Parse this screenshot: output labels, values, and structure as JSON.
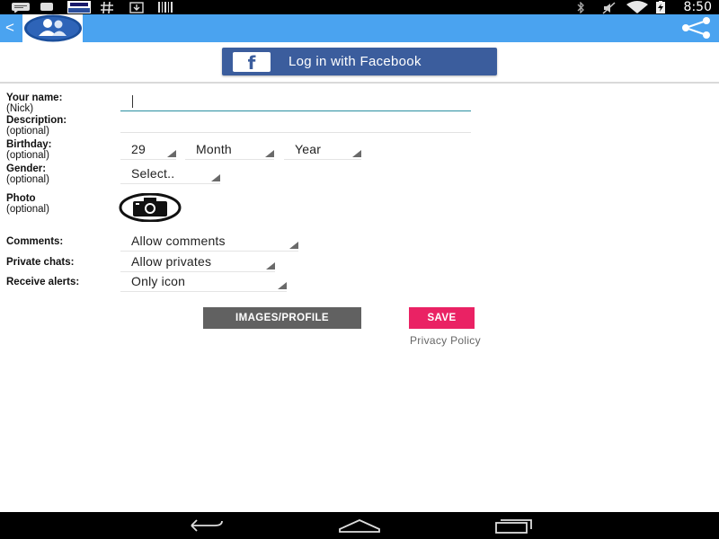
{
  "status_bar": {
    "time": "8:50",
    "left_icons": [
      "message-icon",
      "news-icon",
      "hash-icon",
      "download-icon",
      "barcode-icon"
    ],
    "right_icons": [
      "bluetooth-icon",
      "mute-icon",
      "wifi-icon",
      "battery-charging-icon"
    ]
  },
  "action_bar": {
    "back": "<",
    "logo_icon": "users-icon",
    "share_icon": "share-icon",
    "color": "#4aa3f0"
  },
  "facebook": {
    "label": "Log in with Facebook",
    "logo": "f",
    "color": "#3b5d9d"
  },
  "form": {
    "name": {
      "label": "Your name:",
      "sub": "(Nick)",
      "value": ""
    },
    "description": {
      "label": "Description:",
      "sub": "(optional)",
      "value": ""
    },
    "birthday": {
      "label": "Birthday:",
      "sub": "(optional)",
      "day": "29",
      "month": "Month",
      "year": "Year"
    },
    "gender": {
      "label": "Gender:",
      "sub": "(optional)",
      "value": "Select.."
    },
    "photo": {
      "label": "Photo",
      "sub": "(optional)",
      "icon": "camera-icon"
    },
    "comments": {
      "label": "Comments:",
      "value": "Allow comments"
    },
    "private_chats": {
      "label": "Private chats:",
      "value": "Allow privates"
    },
    "receive_alerts": {
      "label": "Receive alerts:",
      "value": "Only icon"
    }
  },
  "buttons": {
    "images_profile": "IMAGES/PROFILE",
    "save": "SAVE",
    "save_color": "#ea2264",
    "images_color": "#616161"
  },
  "privacy_policy": "Privacy Policy",
  "nav_bar": {
    "icons": [
      "back-nav-icon",
      "home-nav-icon",
      "recents-nav-icon"
    ]
  }
}
